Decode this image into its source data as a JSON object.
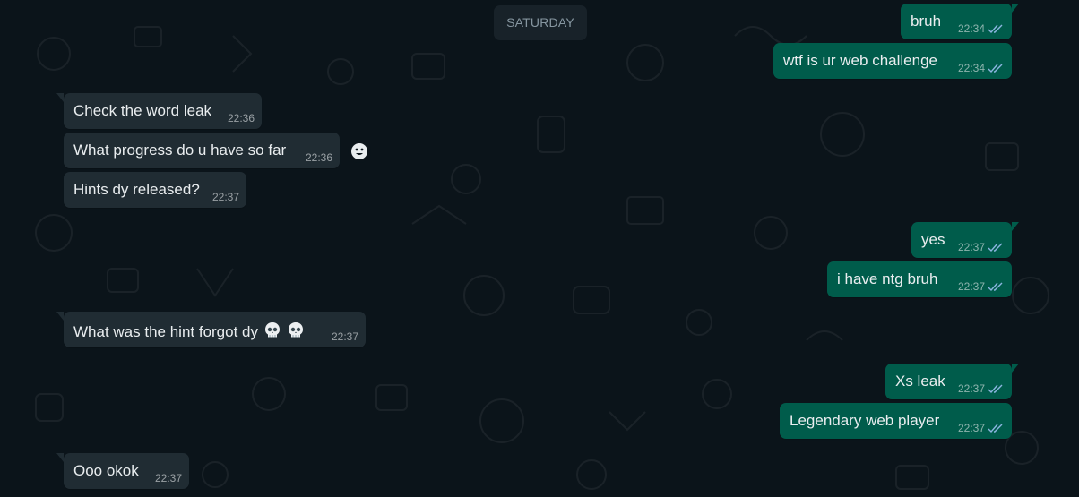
{
  "date_separator": "SATURDAY",
  "colors": {
    "background": "#0b141a",
    "incoming_bubble": "#202c33",
    "outgoing_bubble": "#005c4b",
    "date_chip": "#182229",
    "read_ticks": "#8bb5e0"
  },
  "messages": [
    {
      "direction": "outgoing",
      "text": "bruh",
      "time": "22:34",
      "status": "read"
    },
    {
      "direction": "outgoing",
      "text": "wtf is ur web challenge",
      "time": "22:34",
      "status": "read"
    },
    {
      "direction": "incoming",
      "text": "Check the word leak",
      "time": "22:36"
    },
    {
      "direction": "incoming",
      "text": "What progress do u have so far",
      "time": "22:36"
    },
    {
      "direction": "incoming",
      "text": "Hints dy released?",
      "time": "22:37"
    },
    {
      "direction": "outgoing",
      "text": "yes",
      "time": "22:37",
      "status": "read"
    },
    {
      "direction": "outgoing",
      "text": "i have ntg bruh",
      "time": "22:37",
      "status": "read"
    },
    {
      "direction": "incoming",
      "text": "What was the hint forgot dy",
      "emoji": "skull-icon x2",
      "time": "22:37"
    },
    {
      "direction": "outgoing",
      "text": "Xs leak",
      "time": "22:37",
      "status": "read"
    },
    {
      "direction": "outgoing",
      "text": "Legendary web player",
      "time": "22:37",
      "status": "read"
    },
    {
      "direction": "incoming",
      "text": "Ooo okok",
      "time": "22:37"
    }
  ],
  "reaction_button_icon": "smiley-icon"
}
